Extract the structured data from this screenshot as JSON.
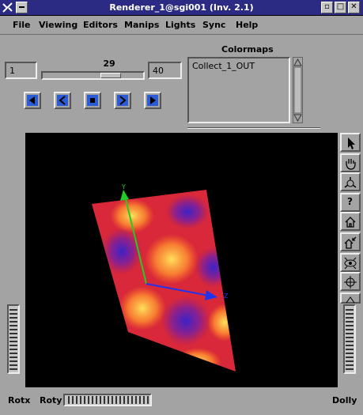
{
  "window": {
    "title": "Renderer_1@sgi001 (Inv. 2.1)",
    "minimize_glyph": "▫",
    "maximize_glyph": "□",
    "close_glyph": "✕"
  },
  "menu": {
    "file": "File",
    "viewing": "Viewing",
    "editors": "Editors",
    "manips": "Manips",
    "lights": "Lights",
    "sync": "Sync",
    "help": "Help"
  },
  "animation": {
    "start_value": "1",
    "current_frame": "29",
    "end_value": "40",
    "slider_fraction": 0.72
  },
  "colormaps": {
    "heading": "Colormaps",
    "items": [
      "Collect_1_OUT"
    ]
  },
  "viewer": {
    "axis_y": "Y",
    "axis_z": "Z",
    "thumbwheel_left_label": "Rotx",
    "thumbwheel_bottom_label": "Roty",
    "thumbwheel_right_label": "Dolly",
    "help_glyph": "?"
  },
  "icons": {
    "nav": [
      "first-frame-icon",
      "step-back-icon",
      "stop-icon",
      "step-forward-icon",
      "last-frame-icon"
    ],
    "side": [
      "pointer-icon",
      "hand-icon",
      "seek-icon",
      "help-icon",
      "home-icon",
      "set-home-icon",
      "view-all-icon",
      "seek-target-icon",
      "perspective-icon"
    ]
  },
  "colors": {
    "titlebar": "#2b2b84",
    "panel": "#a3a3a3",
    "y_axis": "#22cc22",
    "z_axis": "#2233ee"
  }
}
